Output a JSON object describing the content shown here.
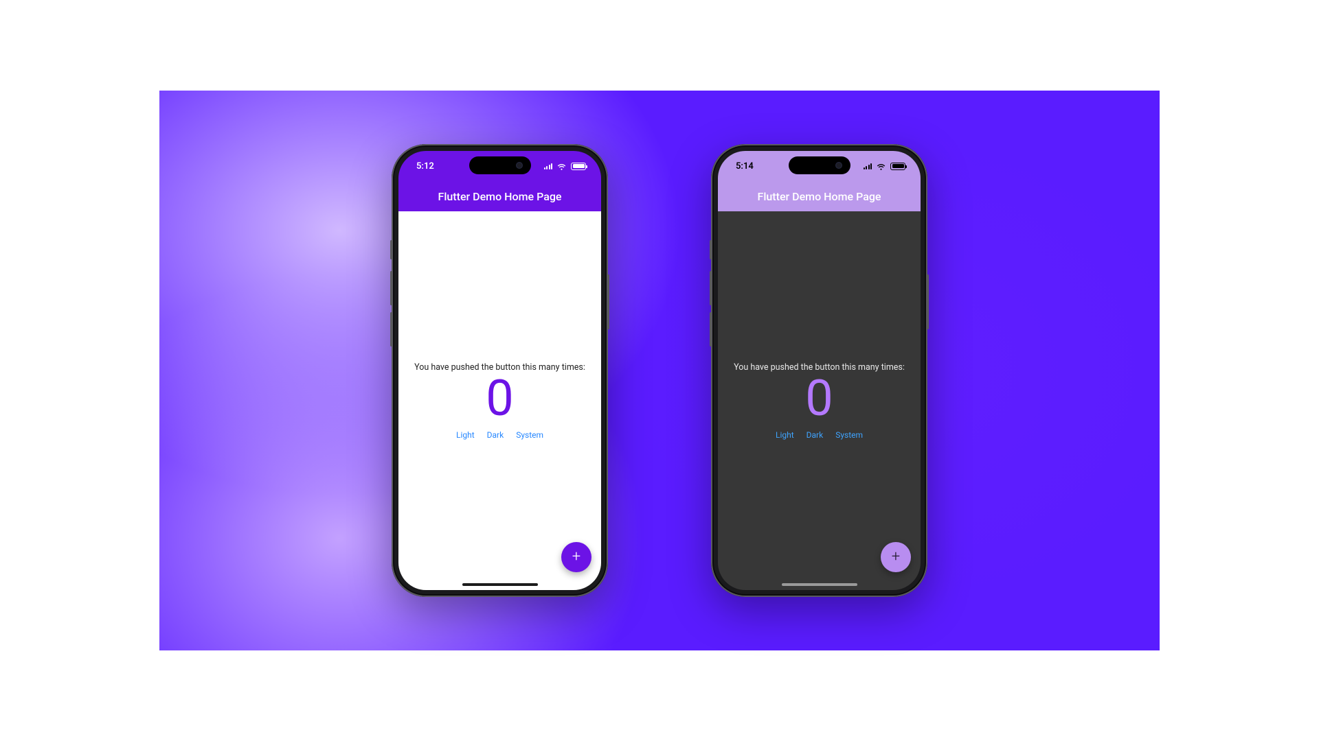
{
  "colors": {
    "appbar_light": "#6c13e6",
    "appbar_dark": "#bb99ec",
    "fab_light": "#6c13e6",
    "fab_dark": "#b88df0",
    "counter_light": "#6c13e6",
    "counter_dark": "#b479ff",
    "link": "#2687ff"
  },
  "light": {
    "status_time": "5:12",
    "appbar_title": "Flutter Demo Home Page",
    "body_message": "You have pushed the button this many times:",
    "counter": "0",
    "options": {
      "light": "Light",
      "dark": "Dark",
      "system": "System"
    },
    "fab_icon": "plus"
  },
  "dark": {
    "status_time": "5:14",
    "appbar_title": "Flutter Demo Home Page",
    "body_message": "You have pushed the button this many times:",
    "counter": "0",
    "options": {
      "light": "Light",
      "dark": "Dark",
      "system": "System"
    },
    "fab_icon": "plus"
  }
}
